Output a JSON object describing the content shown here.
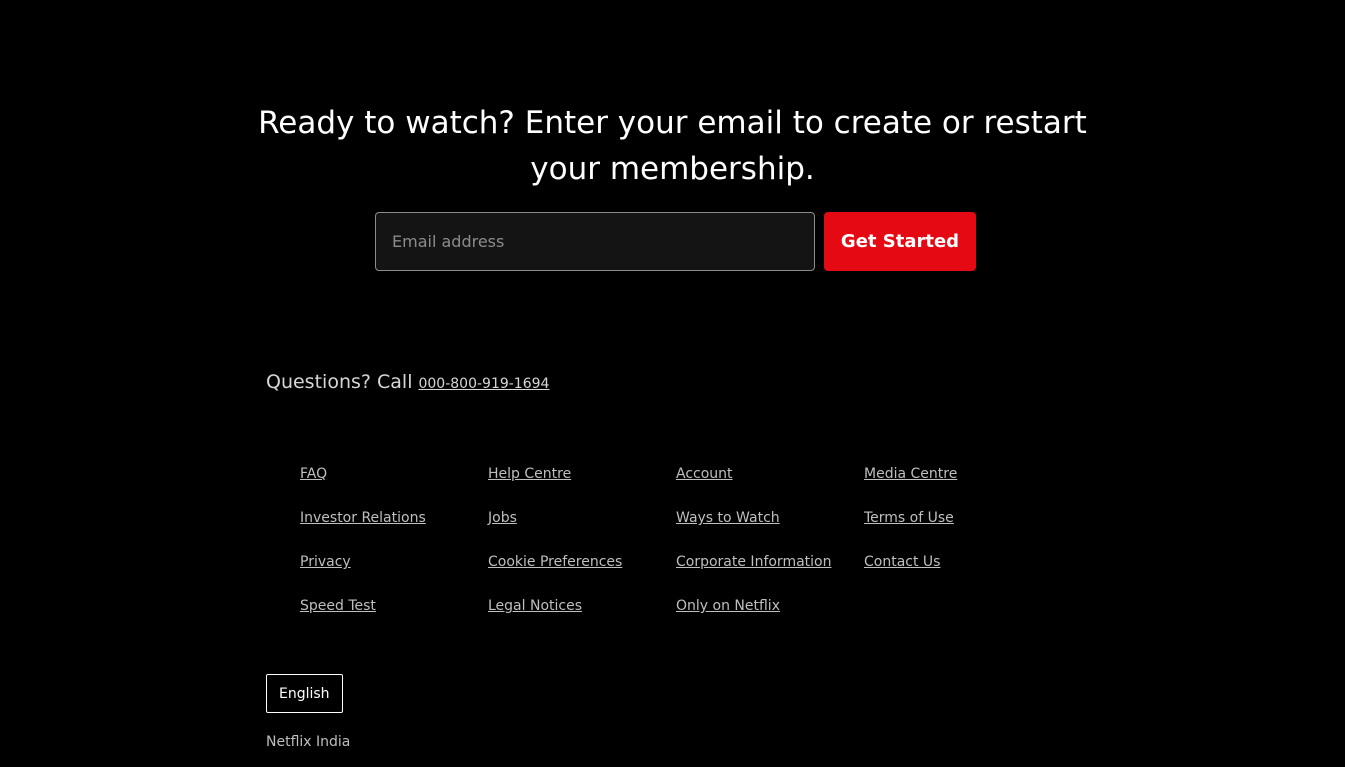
{
  "hero": {
    "headline_line1": "Ready to watch? Enter your email to create or restart",
    "headline_line2": "your membership.",
    "email_placeholder": "Email address",
    "email_value": "",
    "cta_label": "Get Started"
  },
  "contact": {
    "prefix": "Questions? Call",
    "phone": "000-800-919-1694"
  },
  "footer": {
    "links": [
      "FAQ",
      "Help Centre",
      "Account",
      "Media Centre",
      "Investor Relations",
      "Jobs",
      "Ways to Watch",
      "Terms of Use",
      "Privacy",
      "Cookie Preferences",
      "Corporate Information",
      "Contact Us",
      "Speed Test",
      "Legal Notices",
      "Only on Netflix"
    ],
    "language_label": "English",
    "country_label": "Netflix India"
  },
  "colors": {
    "background": "#000000",
    "accent": "#e50914",
    "input_background": "#141414",
    "link_text": "#bfbfbf"
  }
}
